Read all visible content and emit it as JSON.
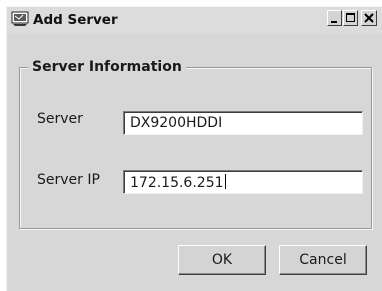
{
  "window": {
    "title": "Add Server"
  },
  "group": {
    "title": "Server Information"
  },
  "fields": {
    "server_label": "Server",
    "server_value": "DX9200HDDI",
    "ip_label": "Server IP",
    "ip_value": "172.15.6.251"
  },
  "buttons": {
    "ok_label": "OK",
    "cancel_label": "Cancel"
  },
  "icons": {
    "title": "server-app-icon",
    "minimize": "minimize-icon",
    "maximize": "maximize-icon",
    "close": "close-icon"
  }
}
